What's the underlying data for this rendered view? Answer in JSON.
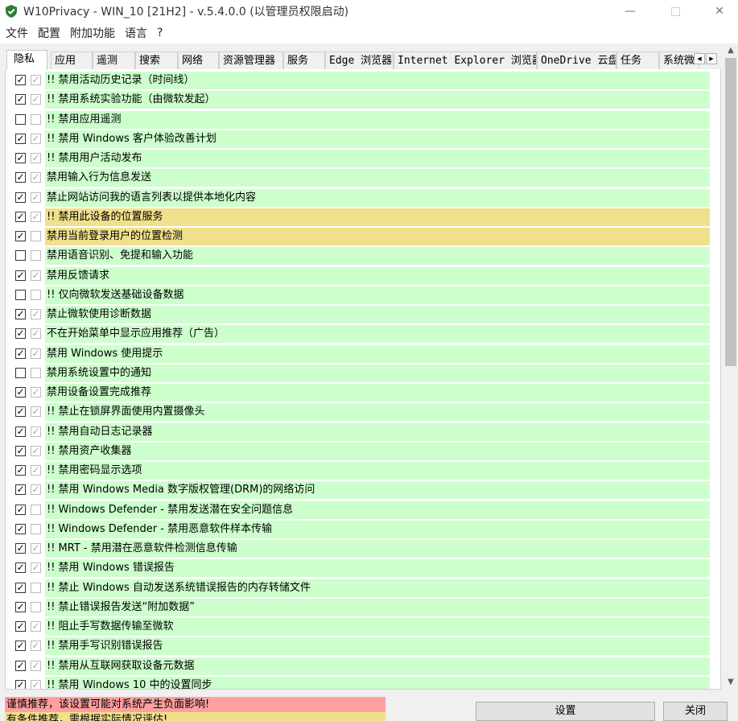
{
  "window": {
    "title": "W10Privacy - WIN_10 [21H2]  - v.5.4.0.0 (以管理员权限启动)",
    "minimize_glyph": "—",
    "close_glyph": "✕"
  },
  "menu": [
    "文件",
    "配置",
    "附加功能",
    "语言",
    "?"
  ],
  "tabs": [
    "隐私",
    "应用",
    "遥测",
    "搜索",
    "网络",
    "资源管理器",
    "服务",
    "Edge 浏览器",
    "Internet Explorer 浏览器",
    "OneDrive 云盘",
    "任务",
    "系统微"
  ],
  "tab_scroll": {
    "left": "◀",
    "right": "▶"
  },
  "check_glyph": "✓",
  "rows": [
    {
      "label": "!! 禁用活动历史记录（时间线）",
      "c1": true,
      "c2": true,
      "color": "green"
    },
    {
      "label": "!! 禁用系统实验功能（由微软发起）",
      "c1": true,
      "c2": true,
      "color": "green"
    },
    {
      "label": "!! 禁用应用遥测",
      "c1": false,
      "c2": false,
      "color": "green"
    },
    {
      "label": "!! 禁用 Windows 客户体验改善计划",
      "c1": true,
      "c2": true,
      "color": "green"
    },
    {
      "label": "!! 禁用用户活动发布",
      "c1": true,
      "c2": true,
      "color": "green"
    },
    {
      "label": "禁用输入行为信息发送",
      "c1": true,
      "c2": true,
      "color": "green"
    },
    {
      "label": "禁止网站访问我的语言列表以提供本地化内容",
      "c1": true,
      "c2": true,
      "color": "green"
    },
    {
      "label": "!! 禁用此设备的位置服务",
      "c1": true,
      "c2": true,
      "color": "yellow"
    },
    {
      "label": "禁用当前登录用户的位置检测",
      "c1": true,
      "c2": false,
      "color": "yellow"
    },
    {
      "label": "禁用语音识别、免提和输入功能",
      "c1": false,
      "c2": false,
      "color": "green"
    },
    {
      "label": "禁用反馈请求",
      "c1": true,
      "c2": true,
      "color": "green"
    },
    {
      "label": "!! 仅向微软发送基础设备数据",
      "c1": false,
      "c2": false,
      "color": "green"
    },
    {
      "label": "禁止微软使用诊断数据",
      "c1": true,
      "c2": true,
      "color": "green"
    },
    {
      "label": "不在开始菜单中显示应用推荐（广告）",
      "c1": true,
      "c2": true,
      "color": "green"
    },
    {
      "label": "禁用 Windows 使用提示",
      "c1": true,
      "c2": true,
      "color": "green"
    },
    {
      "label": "禁用系统设置中的通知",
      "c1": false,
      "c2": false,
      "color": "green"
    },
    {
      "label": "禁用设备设置完成推荐",
      "c1": true,
      "c2": true,
      "color": "green"
    },
    {
      "label": "!! 禁止在锁屏界面使用内置摄像头",
      "c1": true,
      "c2": true,
      "color": "green"
    },
    {
      "label": "!! 禁用自动日志记录器",
      "c1": true,
      "c2": true,
      "color": "green"
    },
    {
      "label": "!! 禁用资产收集器",
      "c1": true,
      "c2": true,
      "color": "green"
    },
    {
      "label": "!! 禁用密码显示选项",
      "c1": true,
      "c2": true,
      "color": "green"
    },
    {
      "label": "!! 禁用 Windows Media 数字版权管理(DRM)的网络访问",
      "c1": true,
      "c2": true,
      "color": "green"
    },
    {
      "label": "!! Windows Defender - 禁用发送潜在安全问题信息",
      "c1": true,
      "c2": false,
      "color": "green"
    },
    {
      "label": "!! Windows Defender - 禁用恶意软件样本传输",
      "c1": true,
      "c2": false,
      "color": "green"
    },
    {
      "label": "!! MRT - 禁用潜在恶意软件检测信息传输",
      "c1": true,
      "c2": true,
      "color": "green"
    },
    {
      "label": "!! 禁用 Windows 错误报告",
      "c1": true,
      "c2": true,
      "color": "green"
    },
    {
      "label": "!! 禁止 Windows 自动发送系统错误报告的内存转储文件",
      "c1": true,
      "c2": false,
      "color": "green"
    },
    {
      "label": "!! 禁止错误报告发送“附加数据”",
      "c1": true,
      "c2": false,
      "color": "green"
    },
    {
      "label": "!! 阻止手写数据传输至微软",
      "c1": true,
      "c2": true,
      "color": "green"
    },
    {
      "label": "!! 禁用手写识别错误报告",
      "c1": true,
      "c2": true,
      "color": "green"
    },
    {
      "label": "!! 禁用从互联网获取设备元数据",
      "c1": true,
      "c2": true,
      "color": "green"
    },
    {
      "label": "!! 禁用 Windows 10 中的设置同步",
      "c1": true,
      "c2": true,
      "color": "green"
    }
  ],
  "scrollbar": {
    "up": "▲",
    "down": "▼"
  },
  "legend": {
    "red": "谨慎推荐，该设置可能对系统产生负面影响!",
    "yellow": "有条件推荐，需根据实际情况评估!"
  },
  "buttons": {
    "apply": "设置",
    "close": "关闭"
  },
  "colors": {
    "green": "#ccffcc",
    "yellow": "#f0e08c",
    "red": "#ffa0a0"
  }
}
